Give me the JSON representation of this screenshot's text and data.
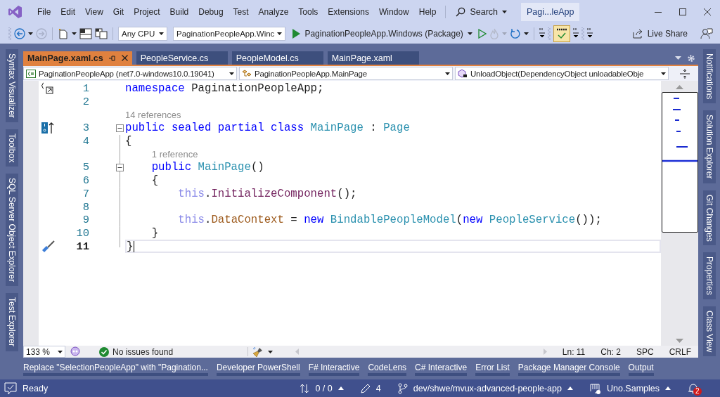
{
  "window": {
    "title": "Pagi...leApp"
  },
  "menu": [
    "File",
    "Edit",
    "View",
    "Git",
    "Project",
    "Build",
    "Debug",
    "Test",
    "Analyze",
    "Tools",
    "Extensions",
    "Window",
    "Help"
  ],
  "search": {
    "label": "Search"
  },
  "toolbar": {
    "platform": "Any CPU",
    "startup_project": "PaginationPeopleApp.Winc",
    "run_target": "PaginationPeopleApp.Windows (Package)",
    "spell_check_on": true,
    "live_share": "Live Share"
  },
  "doc_tabs": [
    {
      "label": "MainPage.xaml.cs",
      "selected": true
    },
    {
      "label": "PeopleService.cs",
      "selected": false
    },
    {
      "label": "PeopleModel.cs",
      "selected": false
    },
    {
      "label": "MainPage.xaml",
      "selected": false
    }
  ],
  "nav_bar": {
    "project": "PaginationPeopleApp (net7.0-windows10.0.19041)",
    "type": "PaginationPeopleApp.MainPage",
    "member": "UnloadObject(DependencyObject unloadableObje"
  },
  "left_tool_tabs": [
    "Syntax Visualizer",
    "Toolbox",
    "SQL Server Object Explorer",
    "Test Explorer"
  ],
  "right_tool_tabs": [
    "Notifications",
    "Solution Explorer",
    "Git Changes",
    "Properties",
    "Class View"
  ],
  "editor": {
    "rows": [
      {
        "kind": "code",
        "number": "1",
        "fold": false,
        "current": false,
        "tokens": [
          {
            "text": "namespace",
            "kind": "keyword"
          },
          {
            "text": " PaginationPeopleApp;",
            "kind": "plain"
          }
        ]
      },
      {
        "kind": "code",
        "number": "2",
        "fold": false,
        "current": false,
        "tokens": []
      },
      {
        "kind": "codelens",
        "text": "14 references"
      },
      {
        "kind": "code",
        "number": "3",
        "fold": true,
        "current": false,
        "tokens": [
          {
            "text": "public sealed partial class",
            "kind": "keyword"
          },
          {
            "text": " MainPage",
            "kind": "type"
          },
          {
            "text": " : ",
            "kind": "plain"
          },
          {
            "text": "Page",
            "kind": "type"
          }
        ]
      },
      {
        "kind": "code",
        "number": "4",
        "fold": false,
        "current": false,
        "tokens": [
          {
            "text": "{",
            "kind": "plain"
          }
        ]
      },
      {
        "kind": "codelens",
        "text": "1 reference"
      },
      {
        "kind": "code",
        "number": "5",
        "fold": true,
        "current": false,
        "tokens": [
          {
            "text": "    public",
            "kind": "keyword"
          },
          {
            "text": " MainPage",
            "kind": "type"
          },
          {
            "text": "()",
            "kind": "plain"
          }
        ]
      },
      {
        "kind": "code",
        "number": "6",
        "fold": false,
        "current": false,
        "tokens": [
          {
            "text": "    {",
            "kind": "plain"
          }
        ]
      },
      {
        "kind": "code",
        "number": "7",
        "fold": false,
        "current": false,
        "tokens": [
          {
            "text": "        this",
            "kind": "this"
          },
          {
            "text": ".",
            "kind": "plain"
          },
          {
            "text": "InitializeComponent",
            "kind": "method"
          },
          {
            "text": "();",
            "kind": "plain"
          }
        ]
      },
      {
        "kind": "code",
        "number": "8",
        "fold": false,
        "current": false,
        "tokens": []
      },
      {
        "kind": "code",
        "number": "9",
        "fold": false,
        "current": false,
        "tokens": [
          {
            "text": "        this",
            "kind": "this"
          },
          {
            "text": ".",
            "kind": "plain"
          },
          {
            "text": "DataContext",
            "kind": "property"
          },
          {
            "text": " = ",
            "kind": "plain"
          },
          {
            "text": "new",
            "kind": "keyword"
          },
          {
            "text": " BindablePeopleModel",
            "kind": "type"
          },
          {
            "text": "(",
            "kind": "plain"
          },
          {
            "text": "new",
            "kind": "keyword"
          },
          {
            "text": " PeopleService",
            "kind": "type"
          },
          {
            "text": "());",
            "kind": "plain"
          }
        ]
      },
      {
        "kind": "code",
        "number": "10",
        "fold": false,
        "current": false,
        "tokens": [
          {
            "text": "    }",
            "kind": "plain"
          }
        ]
      },
      {
        "kind": "code",
        "number": "11",
        "fold": false,
        "current": true,
        "tokens": [
          {
            "text": "}",
            "kind": "plain"
          }
        ]
      }
    ]
  },
  "editor_status": {
    "zoom": "133 %",
    "issues": "No issues found",
    "line": "Ln: 11",
    "column": "Ch: 2",
    "whitespace": "SPC",
    "line_endings": "CRLF"
  },
  "bottom_tabs": [
    "Replace \"SelectionPeopleApp\" with \"Pagination...",
    "Developer PowerShell",
    "F# Interactive",
    "CodeLens",
    "C# Interactive",
    "Error List",
    "Package Manager Console",
    "Output"
  ],
  "status_bar": {
    "state": "Ready",
    "commits": "0 / 0",
    "changes": "4",
    "branch": "dev/shwe/mvux-advanced-people-app",
    "repository": "Uno.Samples",
    "notifications": "2"
  }
}
